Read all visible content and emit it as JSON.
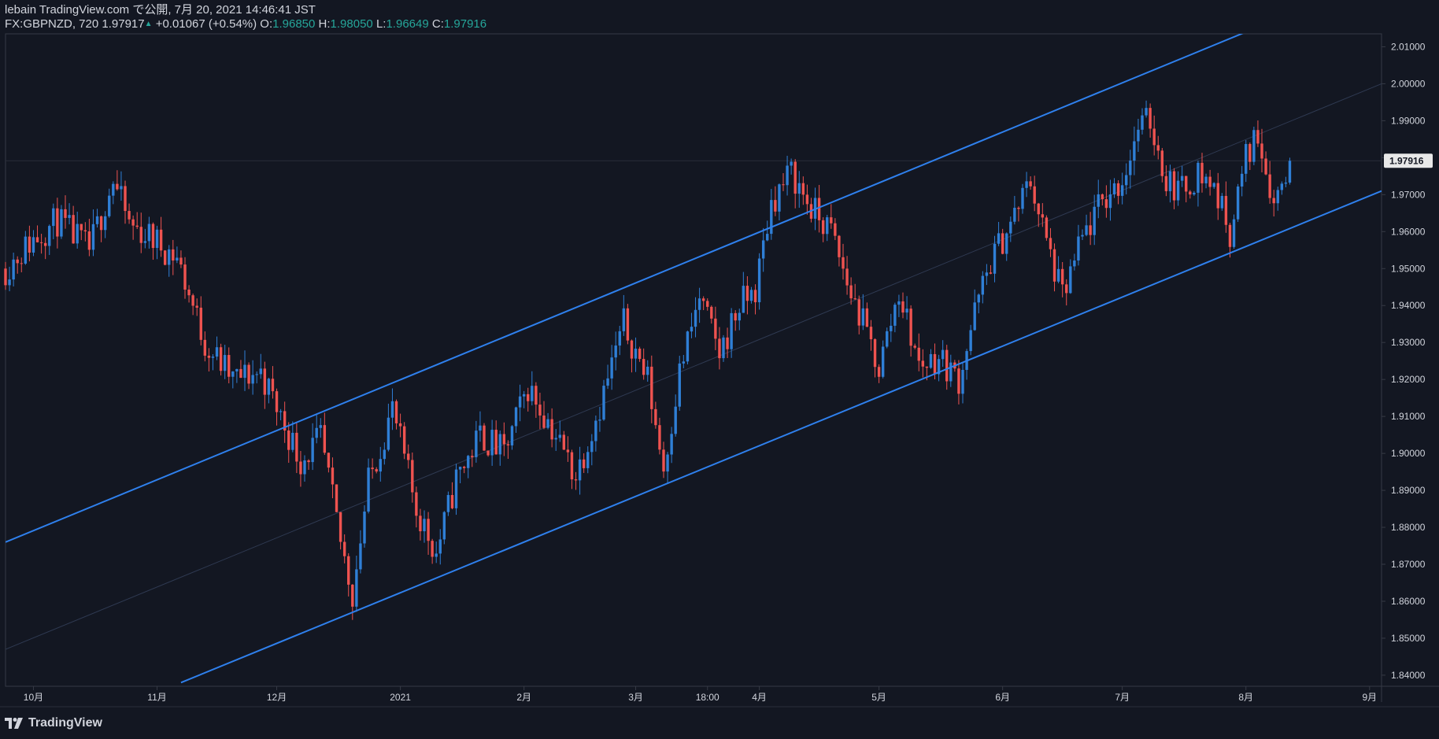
{
  "header": {
    "publish_line": "lebain TradingView.com で公開, 7月 20, 2021 14:46:41 JST",
    "symbol": "FX:GBPNZD, 720",
    "last_price": "1.97917",
    "change": "+0.01067 (+0.54%)",
    "o_label": "O:",
    "o_value": "1.96850",
    "h_label": "H:",
    "h_value": "1.98050",
    "l_label": "L:",
    "l_value": "1.96649",
    "c_label": "C:",
    "c_value": "1.97916"
  },
  "footer": {
    "brand": "TradingView"
  },
  "colors": {
    "background": "#131722",
    "up": "#2f7fd6",
    "down": "#ef5350",
    "channel": "#2f80ed",
    "axis_text": "#d1d4dc",
    "price_tag_bg": "#e8e8e8"
  },
  "chart_data": {
    "type": "candlestick",
    "interval": "720",
    "current_price_label": "1.97916",
    "y_ticks": [
      "2.01000",
      "2.00000",
      "1.99000",
      "1.98000",
      "1.97000",
      "1.96000",
      "1.95000",
      "1.94000",
      "1.93000",
      "1.92000",
      "1.91000",
      "1.90000",
      "1.89000",
      "1.88000",
      "1.87000",
      "1.86000",
      "1.85000",
      "1.84000"
    ],
    "ylim": [
      1.837,
      2.0135
    ],
    "x_labels": [
      "10月",
      "11月",
      "12月",
      "2021",
      "2月",
      "3月",
      "18:00",
      "4月",
      "5月",
      "6月",
      "7月",
      "8月",
      "9月"
    ],
    "x_label_days": [
      0,
      31,
      61,
      92,
      123,
      151,
      169,
      182,
      212,
      243,
      273,
      304,
      335
    ],
    "xlim_days": [
      -7,
      338
    ],
    "price_path": [
      [
        -7,
        1.95
      ],
      [
        0,
        1.958
      ],
      [
        6,
        1.963
      ],
      [
        14,
        1.955
      ],
      [
        20,
        1.974
      ],
      [
        24,
        1.962
      ],
      [
        30,
        1.958
      ],
      [
        36,
        1.953
      ],
      [
        43,
        1.93
      ],
      [
        50,
        1.92
      ],
      [
        57,
        1.922
      ],
      [
        62,
        1.91
      ],
      [
        67,
        1.898
      ],
      [
        72,
        1.904
      ],
      [
        77,
        1.876
      ],
      [
        80,
        1.862
      ],
      [
        84,
        1.892
      ],
      [
        90,
        1.912
      ],
      [
        96,
        1.885
      ],
      [
        101,
        1.873
      ],
      [
        106,
        1.893
      ],
      [
        112,
        1.905
      ],
      [
        118,
        1.9
      ],
      [
        124,
        1.918
      ],
      [
        130,
        1.907
      ],
      [
        136,
        1.894
      ],
      [
        142,
        1.913
      ],
      [
        148,
        1.935
      ],
      [
        154,
        1.92
      ],
      [
        158,
        1.896
      ],
      [
        162,
        1.922
      ],
      [
        167,
        1.942
      ],
      [
        172,
        1.927
      ],
      [
        177,
        1.94
      ],
      [
        181,
        1.944
      ],
      [
        185,
        1.968
      ],
      [
        190,
        1.976
      ],
      [
        195,
        1.966
      ],
      [
        200,
        1.96
      ],
      [
        204,
        1.946
      ],
      [
        208,
        1.935
      ],
      [
        212,
        1.923
      ],
      [
        217,
        1.944
      ],
      [
        222,
        1.924
      ],
      [
        227,
        1.926
      ],
      [
        232,
        1.92
      ],
      [
        236,
        1.938
      ],
      [
        240,
        1.952
      ],
      [
        245,
        1.962
      ],
      [
        250,
        1.974
      ],
      [
        254,
        1.957
      ],
      [
        258,
        1.942
      ],
      [
        263,
        1.958
      ],
      [
        268,
        1.968
      ],
      [
        273,
        1.974
      ],
      [
        277,
        1.988
      ],
      [
        280,
        1.99
      ],
      [
        284,
        1.974
      ],
      [
        288,
        1.971
      ],
      [
        292,
        1.976
      ],
      [
        296,
        1.972
      ],
      [
        300,
        1.96
      ],
      [
        304,
        1.98
      ],
      [
        307,
        1.987
      ],
      [
        311,
        1.968
      ],
      [
        315,
        1.979
      ]
    ],
    "upper_channel": [
      [
        -7,
        1.876
      ],
      [
        304,
        2.014
      ]
    ],
    "lower_channel": [
      [
        37,
        1.838
      ],
      [
        338,
        1.971
      ]
    ],
    "mid_line": [
      [
        -7,
        1.847
      ],
      [
        338,
        2.0
      ]
    ],
    "last_close_day": 315,
    "last_close": 1.97916
  }
}
